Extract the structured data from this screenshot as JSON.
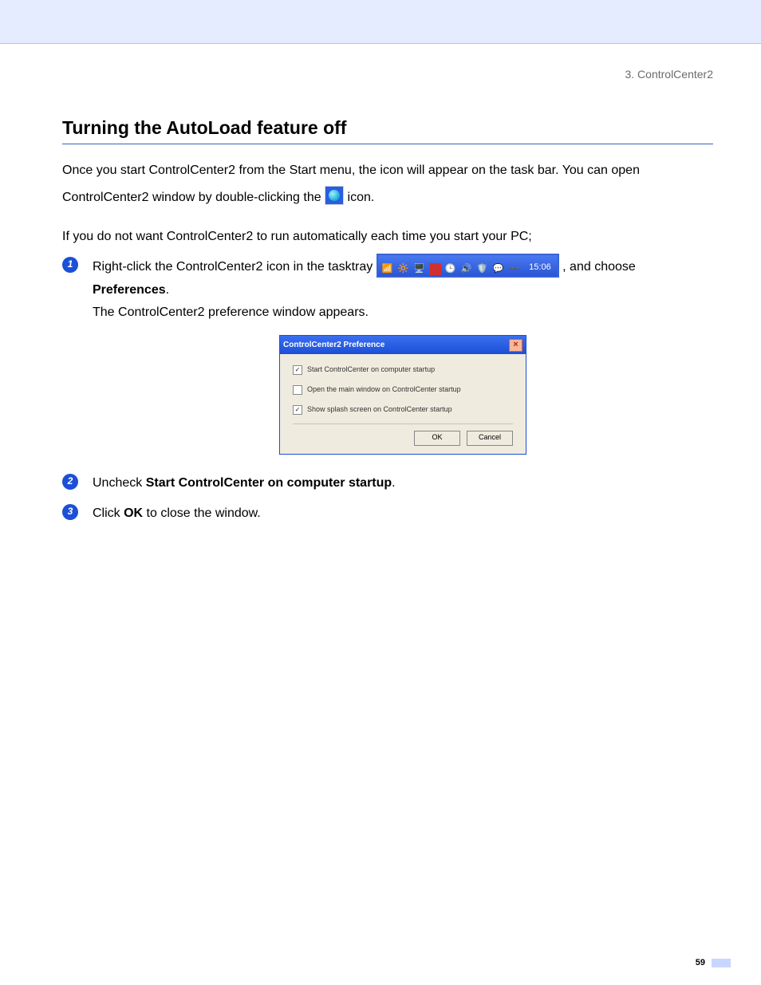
{
  "breadcrumb": "3. ControlCenter2",
  "heading": "Turning the AutoLoad feature off",
  "intro": {
    "p1a": "Once you start ControlCenter2 from the Start menu, the icon will appear on the task bar. You can open ",
    "p1b": "ControlCenter2 window by double-clicking the ",
    "p1c": " icon.",
    "p2": "If you do not want ControlCenter2 to run automatically each time you start your PC;"
  },
  "steps": {
    "s1a": "Right-click the ControlCenter2 icon in the tasktray ",
    "s1b": ", and choose ",
    "s1_pref": "Preferences",
    "s1c": ".",
    "s1d": "The ControlCenter2 preference window appears.",
    "s2a": "Uncheck ",
    "s2b": "Start ControlCenter on computer startup",
    "s2c": ".",
    "s3a": "Click ",
    "s3b": "OK",
    "s3c": " to close the window."
  },
  "tasktray": {
    "time": "15:06"
  },
  "dialog": {
    "title": "ControlCenter2   Preference",
    "opt1": {
      "checked": true,
      "label": "Start ControlCenter on computer startup"
    },
    "opt2": {
      "checked": false,
      "label": "Open the main window on ControlCenter startup"
    },
    "opt3": {
      "checked": true,
      "label": "Show splash screen on ControlCenter startup"
    },
    "ok": "OK",
    "cancel": "Cancel"
  },
  "page_number": "59"
}
